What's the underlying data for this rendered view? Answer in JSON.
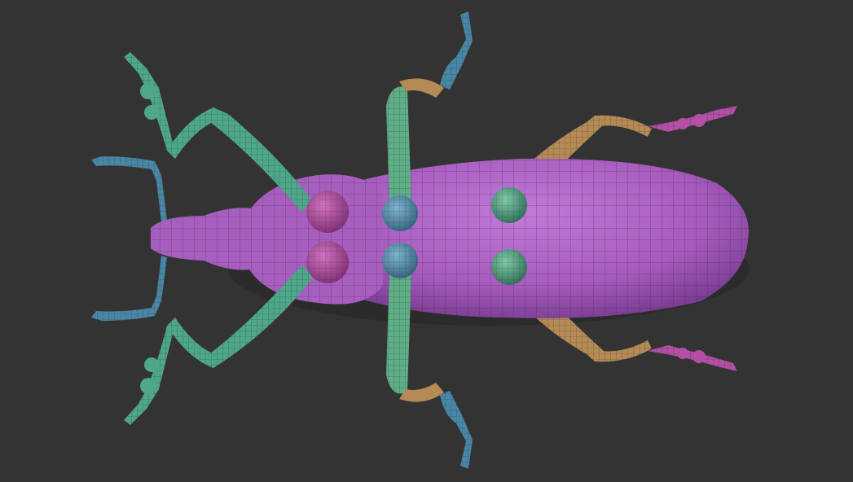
{
  "scene": {
    "subject": "weevil-3d-model",
    "colors": {
      "background": "#333333",
      "body": "#a65fbf",
      "body_shade": "#7d3f93",
      "front_legs": "#4fa78a",
      "mid_legs": "#5fae86",
      "back_legs": "#b58a55",
      "joint_pink": "#b04fa0",
      "joint_blue": "#4f8aa8",
      "tarsus_blue": "#4a86a6",
      "tarsus_pink": "#b44fa6",
      "wire": "#1e1e1e"
    }
  }
}
